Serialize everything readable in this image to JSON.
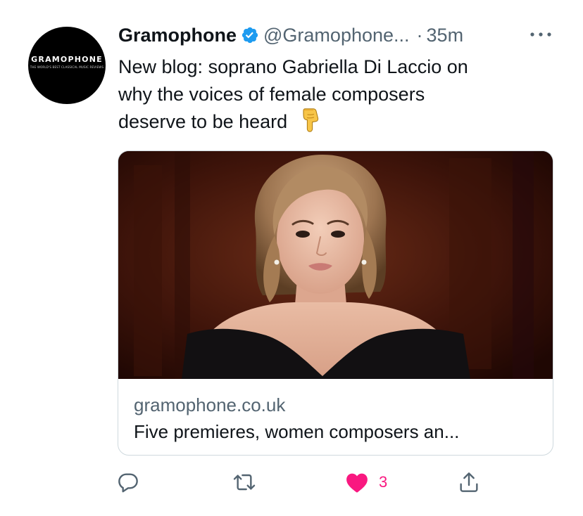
{
  "tweet": {
    "avatar": {
      "wordmark": "GRAMOPHONE",
      "tagline": "THE WORLD'S BEST CLASSICAL MUSIC REVIEWS"
    },
    "display_name": "Gramophone",
    "verified_icon": "verified-badge-icon",
    "handle": "@Gramophone...",
    "separator": "·",
    "timestamp": "35m",
    "more_icon": "more-options-icon",
    "text_lines": [
      "New blog: soprano Gabriella Di Laccio on",
      "why the voices of female composers",
      "deserve to be heard"
    ],
    "emoji": "backhand-index-pointing-down",
    "card": {
      "domain": "gramophone.co.uk",
      "title": "Five premieres, women composers an..."
    },
    "actions": {
      "reply_icon": "reply-icon",
      "retweet_icon": "retweet-icon",
      "like_icon": "heart-filled-icon",
      "like_count": "3",
      "share_icon": "share-icon"
    },
    "colors": {
      "text_primary": "#0f1419",
      "text_secondary": "#536471",
      "verified_blue": "#1d9bf0",
      "like_pink": "#f91880",
      "card_border": "#cfd9de"
    }
  }
}
